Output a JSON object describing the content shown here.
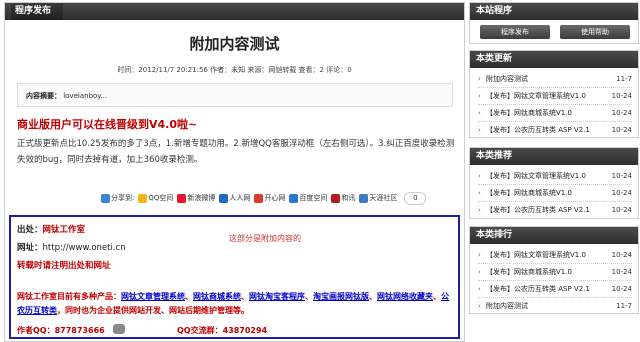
{
  "main": {
    "header": "程序发布",
    "title": "附加内容测试",
    "meta": "时间：2012/11/7 20:21:56    作者：未知    来源：网铠转载    查看：2    评论：0",
    "summary_label": "内容摘要：",
    "summary_text": "loveianboy...",
    "promo": "商业版用户可以在线晋级到V4.0啦~",
    "body": "正式版更新点比10.25发布的多了3点，1.新增专题功用。2.新增QQ客服浮动框（左右侧可选）。3.纠正百度收录检测失效的bug，同时去掉有道，加上360收录检测。",
    "share": {
      "label": "分享到:",
      "items": [
        {
          "name": "QQ空间",
          "color": "#f2b61a"
        },
        {
          "name": "新浪微博",
          "color": "#e6162d"
        },
        {
          "name": "人人网",
          "color": "#1f6bbf"
        },
        {
          "name": "开心网",
          "color": "#d73b2c"
        },
        {
          "name": "百度空间",
          "color": "#2e77d1"
        },
        {
          "name": "和讯",
          "color": "#b51c1c"
        },
        {
          "name": "天涯社区",
          "color": "#3b7bc4"
        }
      ],
      "count": "0"
    },
    "box": {
      "from_label": "出处：",
      "from_value": "网钛工作室",
      "url_label": "网址：",
      "url_value": "http://www.oneti.cn",
      "note_center": "这部分是附加内容的",
      "reprint": "转载时请注明出处和网址",
      "products_prefix": "网钛工作室目前有多种产品：",
      "products": [
        "网钛文章管理系统",
        "网钛商城系统",
        "网钛淘宝客程序",
        "淘宝画报网钛版",
        "网钛网络收藏夹",
        "公农历互转类"
      ],
      "products_suffix": "，同时也为企业提供网站开发、网站后期维护管理等。",
      "qq_author": "作者QQ：877873666",
      "qq_group": "QQ交流群：43870294"
    }
  },
  "sidebar": {
    "site": {
      "header": "本站程序",
      "buttons": [
        "程序发布",
        "使用帮助"
      ]
    },
    "latest": {
      "header": "本类更新",
      "items": [
        {
          "text": "附加内容测试",
          "date": "11-7"
        },
        {
          "text": "【发布】网钛文章管理系统V1.0",
          "date": "10-24"
        },
        {
          "text": "【发布】网钛商城系统V1.0",
          "date": "10-24"
        },
        {
          "text": "【发布】公农历互转类 ASP V2.1",
          "date": "10-24"
        }
      ]
    },
    "recommend": {
      "header": "本类推荐",
      "items": [
        {
          "text": "【发布】网钛文章管理系统V1.0",
          "date": "10-24"
        },
        {
          "text": "【发布】网钛商城系统V1.0",
          "date": "10-24"
        },
        {
          "text": "【发布】公农历互转类 ASP V2.1",
          "date": "10-24"
        }
      ]
    },
    "ranking": {
      "header": "本类排行",
      "items": [
        {
          "text": "【发布】网钛文章管理系统V1.0",
          "date": "10-24"
        },
        {
          "text": "【发布】网钛商城系统V1.0",
          "date": "10-24"
        },
        {
          "text": "【发布】公农历互转类 ASP V2.1",
          "date": "10-24"
        },
        {
          "text": "附加内容测试",
          "date": "11-7"
        }
      ]
    }
  }
}
